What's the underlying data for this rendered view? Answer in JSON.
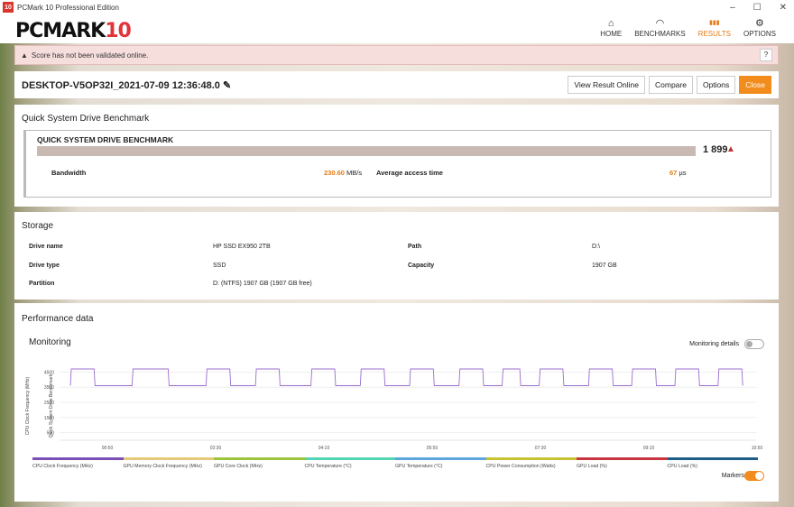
{
  "window": {
    "title": "PCMark 10 Professional Edition",
    "icon": "10",
    "controls": [
      "minimize-icon",
      "maximize-icon",
      "close-icon"
    ]
  },
  "header": {
    "logo_main": "PCMARK",
    "logo_num": "10",
    "nav": [
      {
        "label": "HOME",
        "icon": "⌂"
      },
      {
        "label": "BENCHMARKS",
        "icon": "◠"
      },
      {
        "label": "RESULTS",
        "icon": "▮▮▮"
      },
      {
        "label": "OPTIONS",
        "icon": "⚙"
      }
    ],
    "active_color": "#e47b19"
  },
  "alert": {
    "text": "Score has not been validated online.",
    "help": "?"
  },
  "result": {
    "name": "DESKTOP-V5OP32I_2021-07-09 12:36:48.0",
    "buttons": {
      "view": "View Result Online",
      "compare": "Compare",
      "options": "Options",
      "close": "Close"
    }
  },
  "qsd": {
    "title": "Quick System Drive Benchmark",
    "box_label": "QUICK SYSTEM DRIVE BENCHMARK",
    "score": "1 899",
    "bandwidth_label": "Bandwidth",
    "bandwidth_value": "230.60",
    "bandwidth_unit": "MB/s",
    "access_label": "Average access time",
    "access_value": "67",
    "access_unit": "µs"
  },
  "storage": {
    "title": "Storage",
    "rows": [
      {
        "l1": "Drive name",
        "v1": "HP SSD EX950 2TB",
        "l2": "Path",
        "v2": "D:\\"
      },
      {
        "l1": "Drive type",
        "v1": "SSD",
        "l2": "Capacity",
        "v2": "1907 GB"
      },
      {
        "l1": "Partition",
        "v1": "D: (NTFS) 1907 GB (1907 GB free)",
        "l2": "",
        "v2": ""
      }
    ]
  },
  "perf": {
    "title": "Performance data",
    "monitoring": "Monitoring",
    "monitoring_details": "Monitoring details",
    "markers": "Markers"
  },
  "chart_data": {
    "type": "line",
    "ylabel_left": "CPU Clock Frequency (MHz)",
    "ylabel_right": "Quick System Drive Benchmark",
    "yticks": [
      500,
      1500,
      2500,
      3500,
      4500
    ],
    "ylim": [
      0,
      5000
    ],
    "xticks": [
      "00:50",
      "02:30",
      "04:10",
      "05:50",
      "07:30",
      "09:10",
      "10:50"
    ],
    "series_color": "#9b6fd0",
    "legend": [
      {
        "name": "CPU Clock Frequency (MHz)",
        "color": "#7a4fb8"
      },
      {
        "name": "GPU Memory Clock Frequency (MHz)",
        "color": "#e6c87a"
      },
      {
        "name": "GPU Core Clock (MHz)",
        "color": "#9ec43d"
      },
      {
        "name": "CPU Temperature (°C)",
        "color": "#53d4b2"
      },
      {
        "name": "GPU Temperature (°C)",
        "color": "#5ba7db"
      },
      {
        "name": "CPU Power Consumption (Watts)",
        "color": "#c7c234"
      },
      {
        "name": "GPU Load (%)",
        "color": "#c8343f"
      },
      {
        "name": "CPU Load (%)",
        "color": "#1e5c8a"
      }
    ],
    "series": [
      {
        "name": "CPU Clock Frequency (MHz)",
        "high_periods": [
          [
            0.0,
            0.4
          ],
          [
            1.0,
            1.6
          ],
          [
            2.2,
            2.6
          ],
          [
            3.0,
            3.4
          ],
          [
            3.9,
            4.3
          ],
          [
            4.7,
            5.1
          ],
          [
            5.5,
            5.9
          ],
          [
            6.3,
            6.7
          ],
          [
            7.0,
            7.3
          ],
          [
            7.6,
            8.0
          ],
          [
            8.4,
            8.8
          ],
          [
            9.1,
            9.5
          ],
          [
            9.8,
            10.2
          ],
          [
            10.5,
            10.9
          ]
        ],
        "high": 4700,
        "low": 3600
      }
    ]
  }
}
